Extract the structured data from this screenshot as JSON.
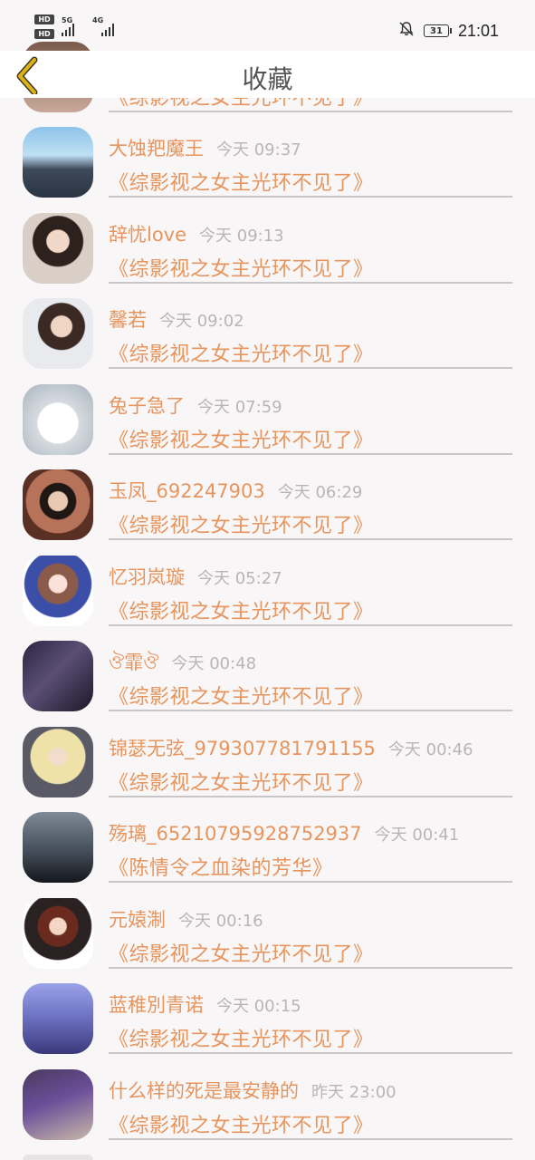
{
  "status_bar": {
    "hd1": "HD",
    "hd2": "HD",
    "net1": "5G",
    "net2": "4G",
    "battery": "31",
    "time": "21:01"
  },
  "header": {
    "title": "收藏"
  },
  "partial_item": {
    "book": "《综影视之女主光环不见了》"
  },
  "items": [
    {
      "nickname": "大蚀羓魔王",
      "time": "今天 09:37",
      "book": "《综影视之女主光环不见了》"
    },
    {
      "nickname": "辞忧love",
      "time": "今天 09:13",
      "book": "《综影视之女主光环不见了》"
    },
    {
      "nickname": "馨若",
      "time": "今天 09:02",
      "book": "《综影视之女主光环不见了》"
    },
    {
      "nickname": "兔子急了",
      "time": "今天 07:59",
      "book": "《综影视之女主光环不见了》"
    },
    {
      "nickname": "玉凤_692247903",
      "time": "今天 06:29",
      "book": "《综影视之女主光环不见了》"
    },
    {
      "nickname": "忆羽岚璇",
      "time": "今天 05:27",
      "book": "《综影视之女主光环不见了》"
    },
    {
      "nickname": "ঔ霏ঔ",
      "time": "今天 00:48",
      "book": "《综影视之女主光环不见了》"
    },
    {
      "nickname": "锦瑟无弦_979307781791155",
      "time": "今天 00:46",
      "book": "《综影视之女主光环不见了》"
    },
    {
      "nickname": "殇璃_65210795928752937",
      "time": "今天 00:41",
      "book": "《陈情令之血染的芳华》"
    },
    {
      "nickname": "元媴淛",
      "time": "今天 00:16",
      "book": "《综影视之女主光环不见了》"
    },
    {
      "nickname": "蓝稚別青诺",
      "time": "今天 00:15",
      "book": "《综影视之女主光环不见了》"
    },
    {
      "nickname": "什么样的死是最安静的",
      "time": "昨天 23:00",
      "book": "《综影视之女主光环不见了》"
    }
  ],
  "colors": {
    "accent": "#e6955e",
    "timestamp": "#b7b5b5",
    "divider": "#c8c6c6",
    "background": "#f8f6f7",
    "back_arrow": "#e0b21a"
  },
  "icons": {
    "back": "chevron-left-icon",
    "mute": "bell-off-icon",
    "battery": "battery-icon",
    "signal": "signal-icon"
  }
}
